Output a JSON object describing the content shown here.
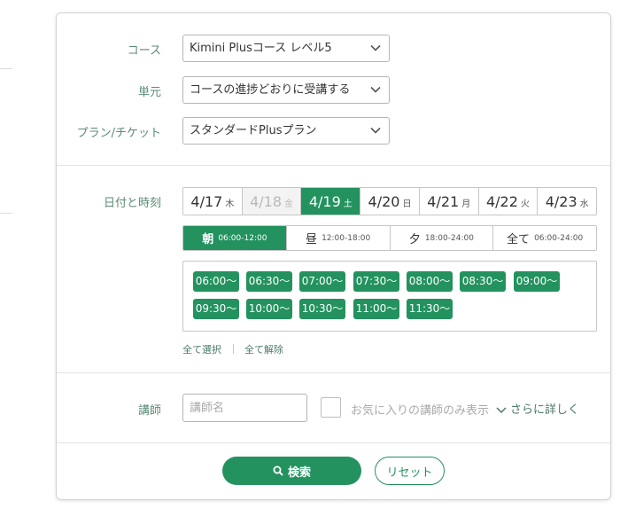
{
  "form": {
    "course": {
      "label": "コース",
      "value": "Kimini Plusコース レベル5"
    },
    "unit": {
      "label": "単元",
      "value": "コースの進捗どおりに受講する"
    },
    "plan": {
      "label": "プラン/チケット",
      "value": "スタンダードPlusプラン"
    },
    "datetime_label": "日付と時刻",
    "dates": [
      {
        "date": "4/17",
        "dow": "木",
        "state": "normal"
      },
      {
        "date": "4/18",
        "dow": "金",
        "state": "disabled"
      },
      {
        "date": "4/19",
        "dow": "土",
        "state": "active"
      },
      {
        "date": "4/20",
        "dow": "日",
        "state": "normal"
      },
      {
        "date": "4/21",
        "dow": "月",
        "state": "normal"
      },
      {
        "date": "4/22",
        "dow": "火",
        "state": "normal"
      },
      {
        "date": "4/23",
        "dow": "水",
        "state": "normal"
      }
    ],
    "periods": [
      {
        "name": "朝",
        "range": "06:00-12:00",
        "active": true
      },
      {
        "name": "昼",
        "range": "12:00-18:00",
        "active": false
      },
      {
        "name": "夕",
        "range": "18:00-24:00",
        "active": false
      },
      {
        "name": "全て",
        "range": "06:00-24:00",
        "active": false
      }
    ],
    "slots": [
      "06:00〜",
      "06:30〜",
      "07:00〜",
      "07:30〜",
      "08:00〜",
      "08:30〜",
      "09:00〜",
      "09:30〜",
      "10:00〜",
      "10:30〜",
      "11:00〜",
      "11:30〜"
    ],
    "select_all": "全て選択",
    "deselect_all": "全て解除",
    "teacher_label": "講師",
    "teacher_placeholder": "講師名",
    "favorite_only_label": "お気に入りの講師のみ表示",
    "more_options": "さらに詳しく",
    "search_button": "検索",
    "reset_button": "リセット"
  },
  "colors": {
    "accent": "#23925f",
    "label": "#5b8a76"
  },
  "icons": {
    "select_arrow": "chevron-down-icon",
    "search": "search-icon",
    "more": "chevron-down-icon"
  }
}
